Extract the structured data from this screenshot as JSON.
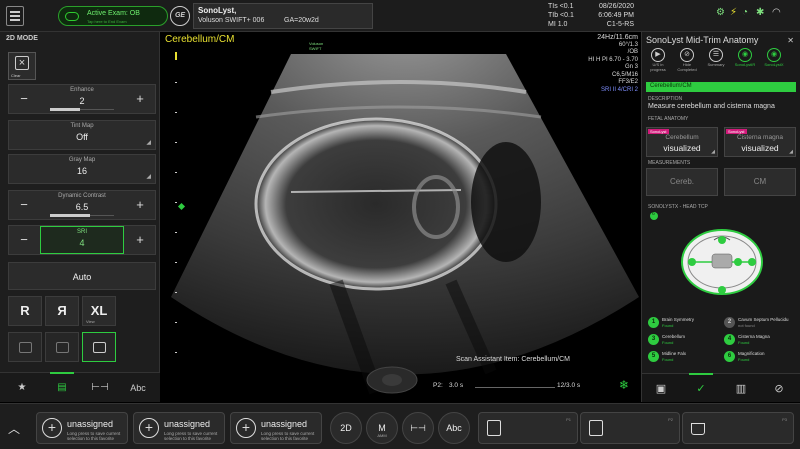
{
  "topbar": {
    "active_exam_title": "Active Exam: OB",
    "active_exam_hint": "Tap here to End Exam",
    "logo_text": "GE",
    "patient_name": "SonoLyst,",
    "probe": "Voluson SWIFT+ 006",
    "ga": "GA=20w2d",
    "indices": [
      "TIs <0.1",
      "TIb <0.1",
      "MI 1.0"
    ],
    "date": "08/26/2020",
    "time": "6:06:49 PM",
    "transducer": "C1-5-RS"
  },
  "left_panel": {
    "mode_title": "2D MODE",
    "clear_label": "Clear",
    "enhance": {
      "label": "Enhance",
      "value": "2"
    },
    "tint_map": {
      "label": "Tint Map",
      "value": "Off"
    },
    "gray_map": {
      "label": "Gray Map",
      "value": "16"
    },
    "dynamic_contrast": {
      "label": "Dynamic Contrast",
      "value": "6.5"
    },
    "sri": {
      "label": "SRI",
      "value": "4"
    },
    "auto_label": "Auto",
    "flip_lr": "Я",
    "flip_ud": "R",
    "xl_label": "XL",
    "view_label": "View",
    "tab_measure_label": "Abc"
  },
  "image": {
    "title": "Cerebellum/CM",
    "mini_label_1": "Voluson",
    "mini_label_2": "SWIFT",
    "params": [
      "24Hz/11.6cm",
      "60°/1.3",
      "/OB",
      "HI H PI 6.70 - 3.70",
      "Gn 3",
      "C6,5/M16",
      "FF3/E2",
      "SRI II 4/CRI 2"
    ],
    "scan_assist": "Scan Assistant Item: Cerebellum/CM",
    "cine_left_label": "P2:",
    "cine_left_time": "3.0 s",
    "cine_right": "12/3.0 s"
  },
  "right_panel": {
    "title": "SonoLyst Mid-Trim Anatomy",
    "tools": [
      {
        "icon": "▶",
        "label": "U/S in progress"
      },
      {
        "icon": "⊘",
        "label": "Hide Completed"
      },
      {
        "icon": "☰",
        "label": "Summary"
      },
      {
        "icon": "◉",
        "label": "SonoLystIR"
      },
      {
        "icon": "◉",
        "label": "SonoLystX"
      }
    ],
    "header_strip": "Cerebellum/CM",
    "description_label": "DESCRIPTION",
    "description": "Measure cerebellum and cisterna magna",
    "fetal_anatomy_label": "FETAL ANATOMY",
    "badge": "SonoLyst",
    "anatomy": [
      {
        "name": "Cerebellum",
        "value": "visualized"
      },
      {
        "name": "Cisterna magna",
        "value": "visualized"
      }
    ],
    "measurements_label": "MEASUREMENTS",
    "measurements": [
      "Cereb.",
      "CM"
    ],
    "head_label": "SONOLYSTX - HEAD TCP",
    "diagram_dot_label": "6",
    "checklist": [
      {
        "num": "1",
        "name": "Brain Symmetry",
        "status": "Found",
        "found": true
      },
      {
        "num": "2",
        "name": "Cavum Septum Pellucidu",
        "status": "not found",
        "found": false
      },
      {
        "num": "3",
        "name": "Cerebellum",
        "status": "Found",
        "found": true
      },
      {
        "num": "4",
        "name": "Cisterna Magna",
        "status": "Found",
        "found": true
      },
      {
        "num": "5",
        "name": "Midline Falx",
        "status": "Found",
        "found": true
      },
      {
        "num": "6",
        "name": "Magnification",
        "status": "Found",
        "found": true
      }
    ]
  },
  "bottombar": {
    "favorites": [
      {
        "title": "unassigned",
        "hint": "Long press to save current selection to this favorite"
      },
      {
        "title": "unassigned",
        "hint": "Long press to save current selection to this favorite"
      },
      {
        "title": "unassigned",
        "hint": "Long press to save current selection to this favorite"
      }
    ],
    "mode_2d": "2D",
    "mode_m": "M",
    "mode_m_sub": "AMM",
    "mode_abc": "Abc",
    "p_buttons": [
      "P1",
      "P2",
      "P3"
    ]
  },
  "colors": {
    "accent": "#2ecc40",
    "title_yellow": "#e8e030",
    "badge_pink": "#d11a7a"
  }
}
